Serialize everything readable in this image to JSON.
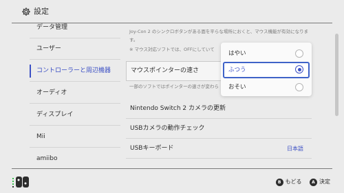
{
  "header": {
    "title": "設定",
    "icon": "gear-icon"
  },
  "sidebar": {
    "items": [
      {
        "label": "データ管理"
      },
      {
        "label": "ユーザー"
      },
      {
        "label": "コントローラーと周辺機器",
        "active": true
      },
      {
        "label": "オーディオ"
      },
      {
        "label": "ディスプレイ"
      },
      {
        "label": "Mii"
      },
      {
        "label": "amiibo"
      }
    ]
  },
  "content": {
    "desc1": "Joy-Con 2 のシンクロボタンがある面を平らな場所におくと、マウス機能が有効になります。",
    "desc2": "※ マウス対応ソフトでは、OFFにしていて",
    "desc3": "一部のソフトではポインターの速さが変わら",
    "rows": {
      "pointer_speed": "マウスポインターの速さ",
      "camera_update": "Nintendo Switch 2 カメラの更新",
      "usb_camera": "USBカメラの動作チェック",
      "usb_keyboard": "USBキーボード",
      "usb_keyboard_value": "日本語"
    }
  },
  "dropdown": {
    "options": [
      "はやい",
      "ふつう",
      "おそい"
    ],
    "selected": "ふつう"
  },
  "footer": {
    "back_glyph": "B",
    "back_label": "もどる",
    "ok_glyph": "A",
    "ok_label": "決定"
  },
  "colors": {
    "accent": "#3b4fc4",
    "joycon_left": "#36c24a",
    "joycon_right": "#e0303a"
  }
}
